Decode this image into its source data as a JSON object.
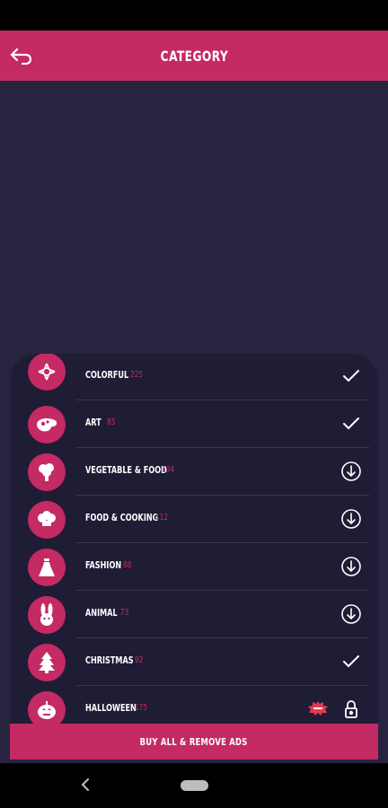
{
  "app_bar": {
    "title": "CATEGORY",
    "back_icon": "back-arrow-icon"
  },
  "theme": {
    "accent": "#c42a63",
    "background": "#282440",
    "panel": "#1f1c36",
    "count_color": "#c42a63"
  },
  "categories": [
    {
      "name": "COLORFUL",
      "count": "225",
      "icon": "flower-icon",
      "status": "owned"
    },
    {
      "name": "ART",
      "count": "85",
      "icon": "paint-palette-icon",
      "status": "owned"
    },
    {
      "name": "VEGETABLE & FOOD",
      "count": "134",
      "icon": "broccoli-icon",
      "status": "download"
    },
    {
      "name": "FOOD & COOKING",
      "count": "112",
      "icon": "chef-hat-icon",
      "status": "download"
    },
    {
      "name": "FASHION",
      "count": "88",
      "icon": "dress-icon",
      "status": "download"
    },
    {
      "name": "ANIMAL",
      "count": "73",
      "icon": "bunny-icon",
      "status": "download"
    },
    {
      "name": "CHRISTMAS",
      "count": "92",
      "icon": "christmas-tree-icon",
      "status": "owned"
    },
    {
      "name": "HALLOWEEN",
      "count": "175",
      "icon": "pumpkin-icon",
      "status": "locked",
      "badge": "new-badge-icon"
    }
  ],
  "buy_button": {
    "label": "BUY ALL & REMOVE ADS"
  },
  "system_nav": {
    "back_icon": "nav-back-icon",
    "home_icon": "nav-home-pill-icon"
  }
}
